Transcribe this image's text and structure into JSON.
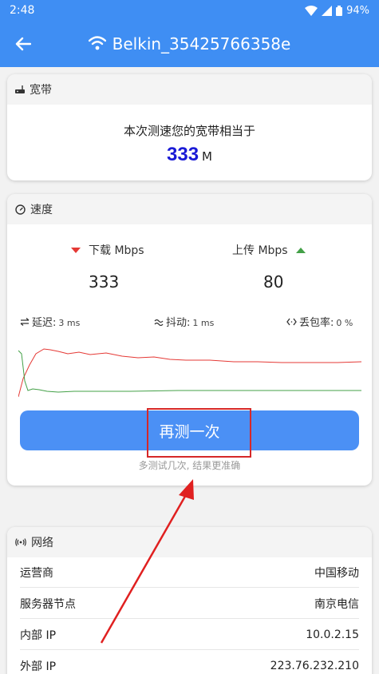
{
  "status_bar": {
    "time": "2:48",
    "battery": "94%"
  },
  "app_bar": {
    "title": "Belkin_35425766358e"
  },
  "broadband": {
    "header": "宽带",
    "line1": "本次测速您的宽带相当于",
    "value": "333",
    "unit": "M"
  },
  "speed": {
    "header": "速度",
    "download_label": "下载 Mbps",
    "upload_label": "上传 Mbps",
    "download_value": "333",
    "upload_value": "80",
    "latency_label": "延迟:",
    "latency_value": "3 ms",
    "jitter_label": "抖动:",
    "jitter_value": "1 ms",
    "loss_label": "丢包率:",
    "loss_value": "0 %",
    "retest_label": "再测一次",
    "hint": "多测试几次, 结果更准确",
    "colors": {
      "download": "#e53935",
      "upload": "#43a047",
      "accent": "#3f8ef3"
    }
  },
  "network": {
    "header": "网络",
    "rows": [
      {
        "label": "运营商",
        "value": "中国移动"
      },
      {
        "label": "服务器节点",
        "value": "南京电信"
      },
      {
        "label": "内部 IP",
        "value": "10.0.2.15"
      },
      {
        "label": "外部 IP",
        "value": "223.76.232.210"
      }
    ]
  }
}
